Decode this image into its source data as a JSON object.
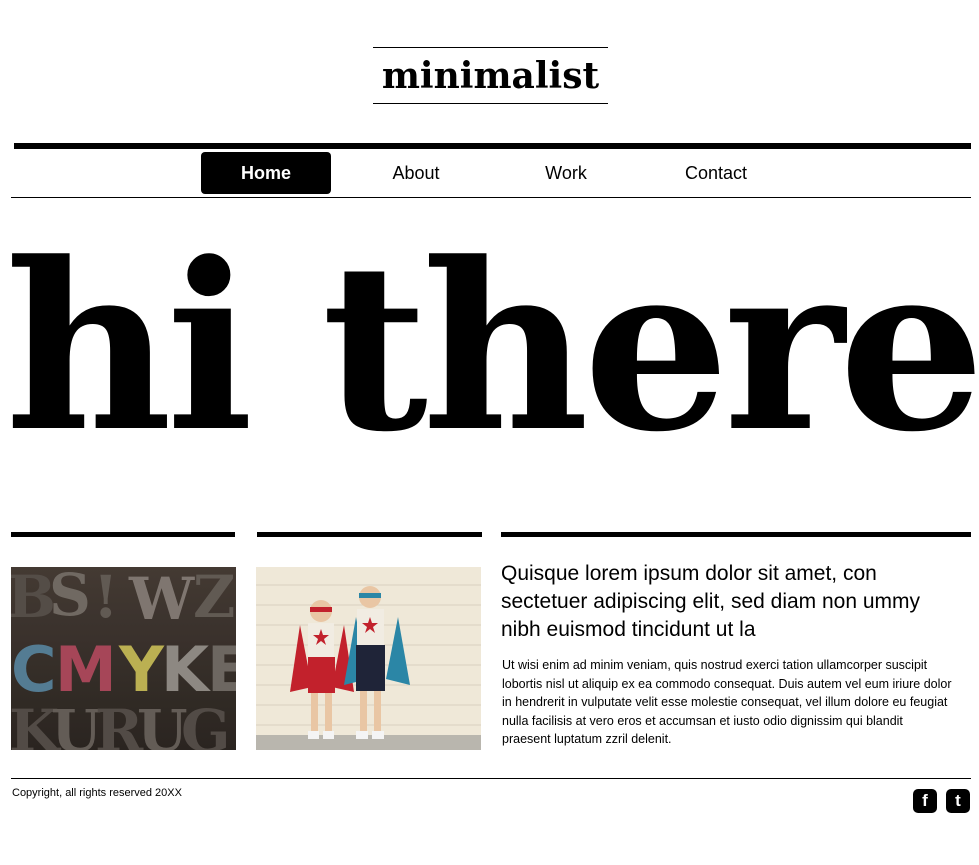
{
  "site": {
    "logo": "minimalist"
  },
  "nav": {
    "items": [
      {
        "label": "Home",
        "active": true
      },
      {
        "label": "About",
        "active": false
      },
      {
        "label": "Work",
        "active": false
      },
      {
        "label": "Contact",
        "active": false
      }
    ]
  },
  "hero": {
    "headline": "hi there"
  },
  "images": [
    {
      "name": "letterpress-wood-type-photo",
      "letters": "CMYK"
    },
    {
      "name": "kids-superhero-photo"
    }
  ],
  "article": {
    "title": "Quisque lorem ipsum dolor sit amet, con sectetuer adipiscing elit, sed diam non ummy nibh euismod tincidunt ut la",
    "body": "Ut wisi enim ad minim veniam, quis nostrud exerci tation ullamcorper suscipit lobortis nisl ut aliquip ex ea commodo consequat. Duis autem vel eum iriure dolor in hendrerit in vulputate velit esse molestie consequat, vel illum dolore eu feugiat nulla facilisis at vero eros et accumsan et iusto odio dignissim qui blandit praesent luptatum zzril delenit."
  },
  "footer": {
    "copyright": "Copyright, all rights reserved 20XX",
    "social": [
      {
        "icon": "facebook-icon",
        "glyph": "f"
      },
      {
        "icon": "twitter-icon",
        "glyph": "t"
      }
    ]
  },
  "colors": {
    "text": "#000000",
    "background": "#ffffff",
    "nav_active_bg": "#000000",
    "nav_active_text": "#ffffff"
  }
}
